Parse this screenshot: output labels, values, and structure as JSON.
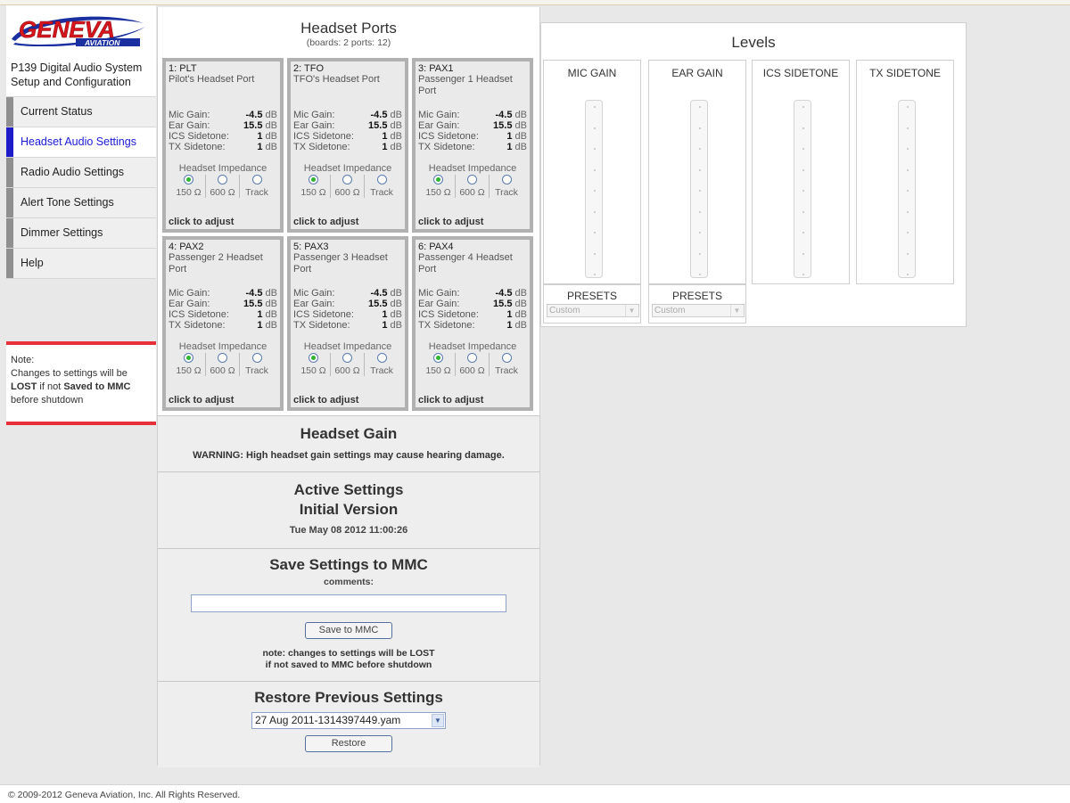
{
  "brand": {
    "logo_text": "GENEVA",
    "logo_sub": "AVIATION",
    "colors": {
      "red": "#d8141c",
      "blue": "#1a2fa0"
    }
  },
  "sidebar": {
    "product_title": "P139 Digital Audio System Setup and Configuration",
    "items": [
      {
        "label": "Current Status"
      },
      {
        "label": "Headset Audio Settings"
      },
      {
        "label": "Radio Audio Settings"
      },
      {
        "label": "Alert Tone Settings"
      },
      {
        "label": "Dimmer Settings"
      },
      {
        "label": "Help"
      }
    ],
    "active_index": 1,
    "note": {
      "p1": "Note",
      "p2": ":",
      "p3": "Changes to settings will be",
      "p4": "LOST",
      "p5": " if not ",
      "p6": "Saved to MMC",
      "p7": "before shutdown"
    }
  },
  "headset_ports": {
    "title": "Headset Ports",
    "subtitle": "(boards: 2 ports: 12)",
    "impedance_label": "Headset Impedance",
    "impedance_options": [
      "150 Ω",
      "600 Ω",
      "Track"
    ],
    "click_label": "click to adjust",
    "mic_label": "Mic Gain:",
    "ear_label": "Ear Gain:",
    "ics_label": "ICS Sidetone:",
    "tx_label": "TX Sidetone:",
    "db_unit": "dB",
    "ports": [
      {
        "id": "1: PLT",
        "name": "Pilot's Headset Port",
        "mic": "-4.5",
        "ear": "15.5",
        "ics": "1",
        "tx": "1",
        "impedance_selected": 0
      },
      {
        "id": "2: TFO",
        "name": "TFO's Headset Port",
        "mic": "-4.5",
        "ear": "15.5",
        "ics": "1",
        "tx": "1",
        "impedance_selected": 0
      },
      {
        "id": "3: PAX1",
        "name": "Passenger 1 Headset Port",
        "mic": "-4.5",
        "ear": "15.5",
        "ics": "1",
        "tx": "1",
        "impedance_selected": 0
      },
      {
        "id": "4: PAX2",
        "name": "Passenger 2 Headset Port",
        "mic": "-4.5",
        "ear": "15.5",
        "ics": "1",
        "tx": "1",
        "impedance_selected": 0
      },
      {
        "id": "5: PAX3",
        "name": "Passenger 3 Headset Port",
        "mic": "-4.5",
        "ear": "15.5",
        "ics": "1",
        "tx": "1",
        "impedance_selected": 0
      },
      {
        "id": "6: PAX4",
        "name": "Passenger 4 Headset Port",
        "mic": "-4.5",
        "ear": "15.5",
        "ics": "1",
        "tx": "1",
        "impedance_selected": 0
      }
    ]
  },
  "headset_gain": {
    "title": "Headset Gain",
    "warning": "WARNING: High headset gain settings may cause hearing damage."
  },
  "active_settings": {
    "title": "Active Settings",
    "version": "Initial Version",
    "date": "Tue May 08 2012 11:00:26"
  },
  "save": {
    "title": "Save Settings to MMC",
    "comments_label": "comments:",
    "comments_value": "",
    "button": "Save to MMC",
    "note_line1": "note: changes to settings will be LOST",
    "note_line2": "if not saved to MMC before shutdown"
  },
  "restore": {
    "title": "Restore Previous Settings",
    "selected": "27 Aug 2011-1314397449.yam",
    "button": "Restore"
  },
  "levels": {
    "title": "Levels",
    "columns": [
      "MIC GAIN",
      "EAR GAIN",
      "ICS SIDETONE",
      "TX SIDETONE"
    ],
    "presets_label": "PRESETS",
    "preset_value": "Custom"
  },
  "footer": {
    "copyright": "© 2009-2012 Geneva Aviation, Inc. All Rights Reserved."
  }
}
